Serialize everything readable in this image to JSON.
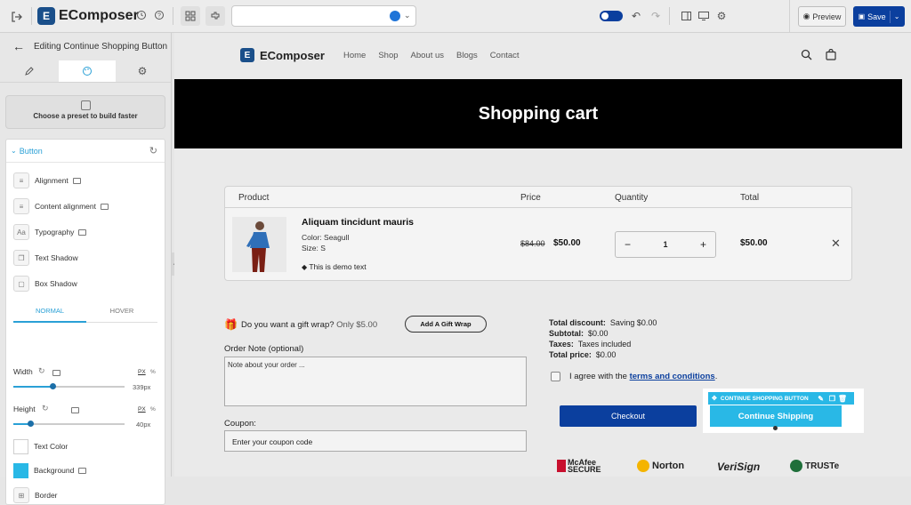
{
  "topbar": {
    "brand": "EComposer",
    "preview_label": "Preview",
    "save_label": "Save"
  },
  "left_panel": {
    "header_title": "Editing Continue Shopping Button",
    "preset_text": "Choose a preset to build faster",
    "section_title": "Button",
    "rows": [
      "Alignment",
      "Content alignment",
      "Typography",
      "Text Shadow",
      "Box Shadow"
    ],
    "state_tabs": {
      "normal": "NORMAL",
      "hover": "HOVER"
    },
    "width_label": "Width",
    "width_unit_px": "PX",
    "width_unit_pct": "%",
    "width_value": "339px",
    "width_fraction": 0.35,
    "height_label": "Height",
    "height_unit_px": "PX",
    "height_unit_pct": "%",
    "height_value": "40px",
    "height_fraction": 0.15,
    "text_color_label": "Text Color",
    "background_label": "Background",
    "border_label": "Border",
    "accent": "#2aa0d6",
    "background_swatch": "#29b8e6"
  },
  "store": {
    "brand": "EComposer",
    "nav": [
      "Home",
      "Shop",
      "About us",
      "Blogs",
      "Contact"
    ],
    "hero_title": "Shopping cart",
    "cart_headers": {
      "product": "Product",
      "price": "Price",
      "quantity": "Quantity",
      "total": "Total"
    },
    "item": {
      "name": "Aliquam tincidunt mauris",
      "color": "Color: Seagull",
      "size": "Size: S",
      "demo_text": "This is demo text",
      "old_price": "$84.00",
      "price": "$50.00",
      "qty": "1",
      "total": "$50.00"
    },
    "gift_wrap": {
      "text": "Do you want a gift wrap?",
      "price_text": "Only $5.00",
      "button": "Add A Gift Wrap"
    },
    "order_note": {
      "label": "Order Note (optional)",
      "placeholder": "Note about your order ..."
    },
    "coupon": {
      "label": "Coupon:",
      "placeholder": "Enter your coupon code"
    },
    "totals": {
      "discount_label": "Total discount:",
      "discount_value": "Saving $0.00",
      "subtotal_label": "Subtotal:",
      "subtotal_value": "$0.00",
      "taxes_label": "Taxes:",
      "taxes_value": "Taxes included",
      "total_label": "Total price:",
      "total_value": "$0.00"
    },
    "agree_text": "I agree with the",
    "agree_link": "terms and conditions",
    "agree_end": ".",
    "checkout_label": "Checkout",
    "selected_toolbar": "CONTINUE SHOPPING BUTTON",
    "continue_label": "Continue Shipping",
    "trust_badges": [
      "McAfee SECURE",
      "Norton",
      "VeriSign",
      "TRUSTe"
    ]
  }
}
